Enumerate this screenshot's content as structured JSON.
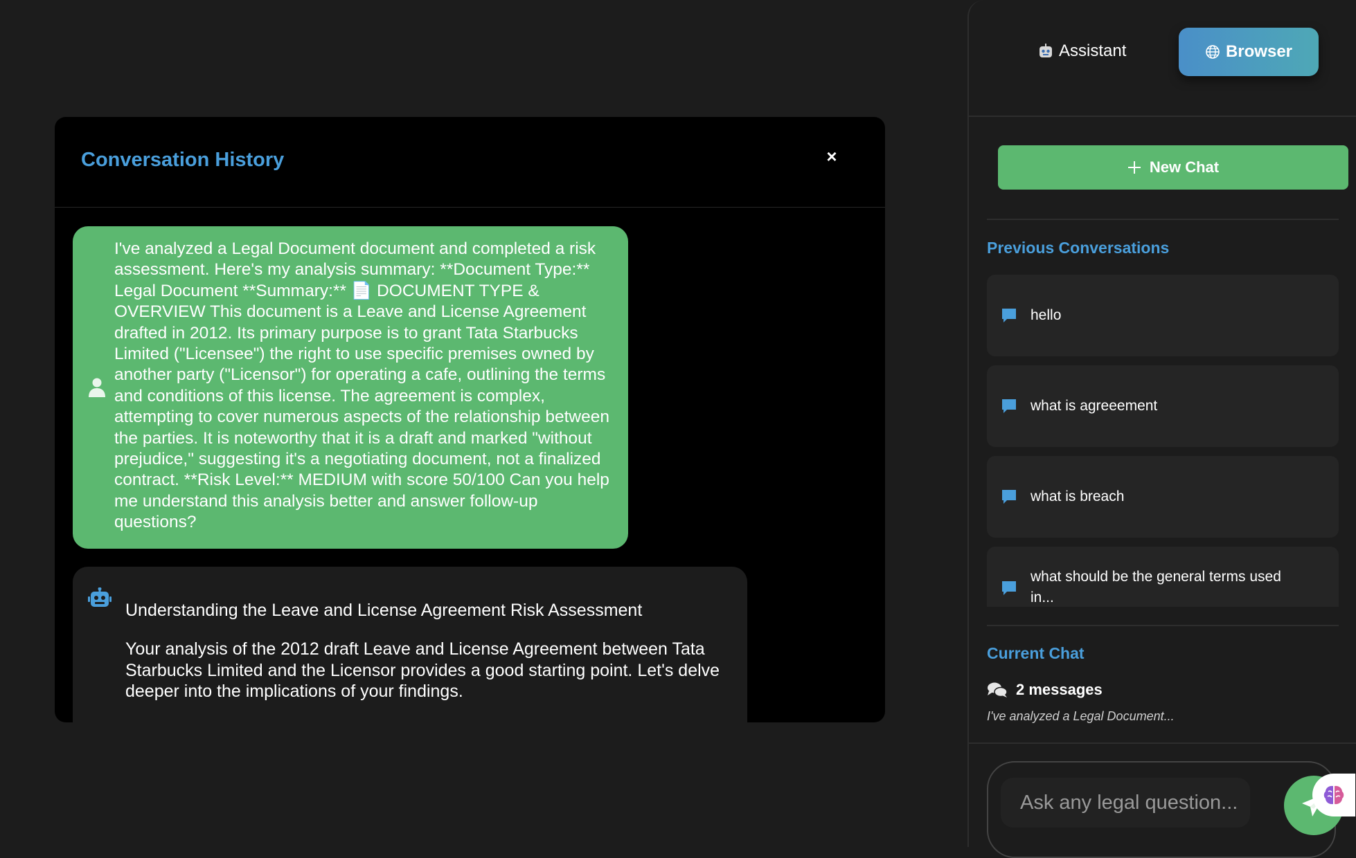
{
  "modal": {
    "title": "Conversation History",
    "close_label": "×",
    "messages": [
      {
        "role": "user",
        "text": "I've analyzed a Legal Document document and completed a risk assessment. Here's my analysis summary: **Document Type:** Legal Document **Summary:** 📄 DOCUMENT TYPE & OVERVIEW This document is a Leave and License Agreement drafted in 2012. Its primary purpose is to grant Tata Starbucks Limited (\"Licensee\") the right to use specific premises owned by another party (\"Licensor\") for operating a cafe, outlining the terms and conditions of this license. The agreement is complex, attempting to cover numerous aspects of the relationship between the parties. It is noteworthy that it is a draft and marked \"without prejudice,\" suggesting it's a negotiating document, not a finalized contract. **Risk Level:** MEDIUM with score 50/100 Can you help me understand this analysis better and answer follow-up questions?"
      },
      {
        "role": "assistant",
        "heading": "Understanding the Leave and License Agreement Risk Assessment",
        "text": "Your analysis of the 2012 draft Leave and License Agreement between Tata Starbucks Limited and the Licensor provides a good starting point. Let's delve deeper into the implications of your findings."
      }
    ]
  },
  "sidebar": {
    "tabs": {
      "assistant": "Assistant",
      "browser": "Browser"
    },
    "new_chat_label": "New Chat",
    "previous_title": "Previous Conversations",
    "conversations": [
      {
        "label": "hello"
      },
      {
        "label": "what is agreeement"
      },
      {
        "label": "what is breach"
      },
      {
        "label": "what should be the general terms used in..."
      }
    ],
    "current_title": "Current Chat",
    "current_count": "2 messages",
    "current_preview": "I've analyzed a Legal Document...",
    "input_placeholder": "Ask any legal question..."
  },
  "colors": {
    "accent_blue": "#4a9fdc",
    "accent_green": "#5cb870",
    "background": "#1c1c1c",
    "modal_bg": "#000000"
  }
}
